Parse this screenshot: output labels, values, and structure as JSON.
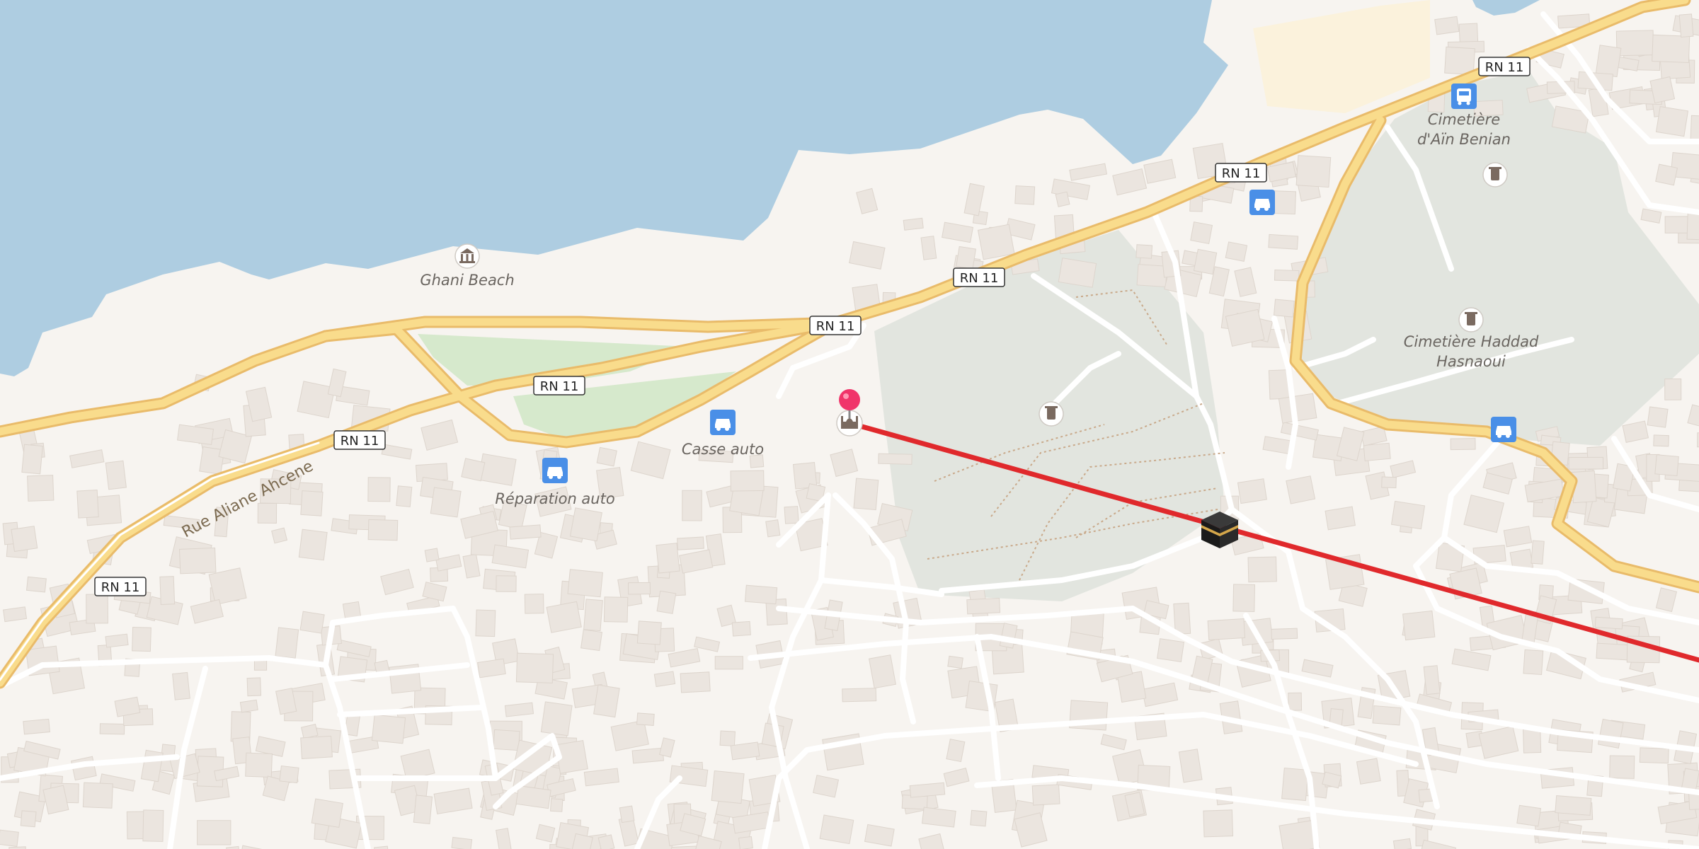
{
  "map": {
    "colors": {
      "water": "#aecde1",
      "land": "#f7f4f0",
      "cemetery": "#e2e5df",
      "park": "#d6e9cc",
      "sand": "#fbf2dc",
      "road_major_fill": "#f9dc8c",
      "road_major_casing": "#e9bb6a",
      "road_minor": "#ffffff",
      "building": "#ebe5df",
      "route_line": "#e0292c",
      "pin": "#f0356a",
      "poi_blue": "#4a8fe7"
    },
    "pois": [
      {
        "name": "Ghani Beach",
        "icon": "museum-icon"
      },
      {
        "name": "Casse auto",
        "icon": "car-icon"
      },
      {
        "name": "Réparation auto",
        "icon": "car-icon"
      },
      {
        "name": "Cimetière",
        "name_line2": "d'Aïn Benian",
        "icon": "cemetery-icon"
      },
      {
        "name": "Cimetière Haddad",
        "name_line2": "Hasnaoui",
        "icon": "cemetery-icon"
      }
    ],
    "road_shields": [
      "RN 11",
      "RN 11",
      "RN 11",
      "RN 11",
      "RN 11",
      "RN 11",
      "RN 11"
    ],
    "street_names": [
      "Rue Aliane Ahcene"
    ],
    "markers": {
      "location_pin": "location-pin-icon",
      "mosque": "mosque-icon",
      "kaaba": "kaaba-icon"
    },
    "route": {
      "description_shown": "qibla-direction-line"
    }
  }
}
